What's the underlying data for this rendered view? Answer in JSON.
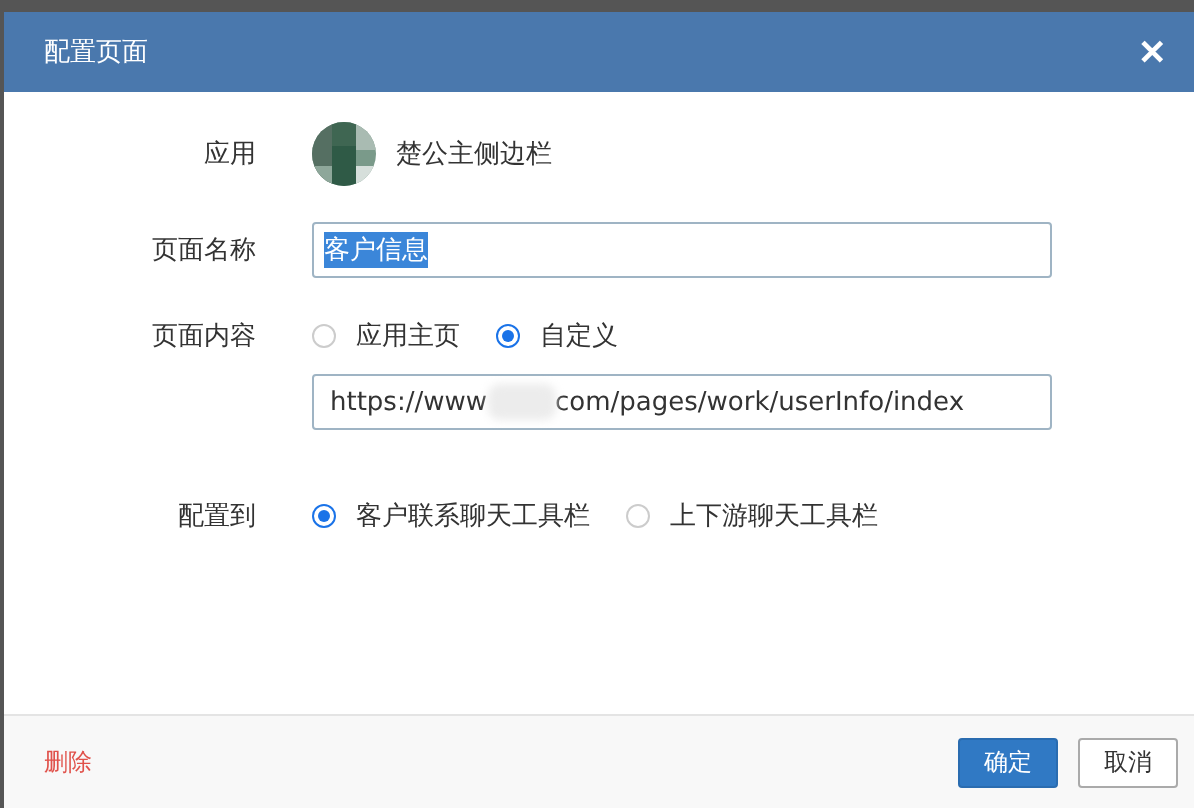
{
  "dialog": {
    "title": "配置页面",
    "close": "✕"
  },
  "app": {
    "label": "应用",
    "name": "楚公主侧边栏"
  },
  "page_name": {
    "label": "页面名称",
    "value": "客户信息",
    "text_selected": true
  },
  "page_content": {
    "label": "页面内容",
    "options": [
      {
        "label": "应用主页",
        "selected": false
      },
      {
        "label": "自定义",
        "selected": true
      }
    ],
    "url": {
      "value_start": "https://www",
      "value_end": "com/pages/work/userInfo/index",
      "blurred": true
    }
  },
  "configure_to": {
    "label": "配置到",
    "options": [
      {
        "label": "客户联系聊天工具栏",
        "selected": true
      },
      {
        "label": "上下游聊天工具栏",
        "selected": false
      }
    ]
  },
  "footer": {
    "delete": "删除",
    "buttons": [
      {
        "label": "确定",
        "kind": "primary"
      },
      {
        "label": "取消",
        "kind": "default"
      }
    ]
  }
}
